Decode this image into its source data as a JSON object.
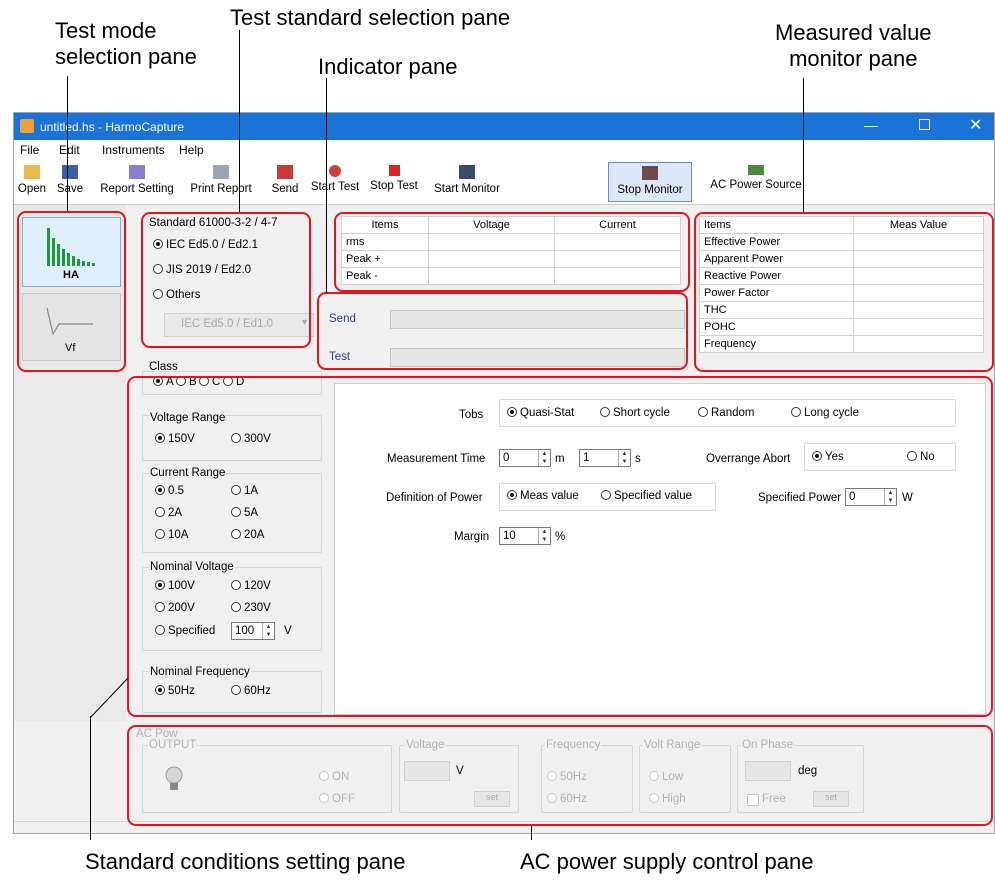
{
  "annotations": {
    "test_mode": "Test mode\nselection pane",
    "test_standard": "Test standard selection pane",
    "indicator": "Indicator pane",
    "measured_value": "Measured value\nmonitor pane",
    "standard_conditions": "Standard conditions setting pane",
    "ac_power": "AC power supply control pane"
  },
  "window": {
    "title": "untitled.hs - HarmoCapture"
  },
  "menu": [
    "File",
    "Edit",
    "Instruments",
    "Help"
  ],
  "toolbar": [
    "Open",
    "Save",
    "Report Setting",
    "Print Report",
    "Send",
    "Start Test",
    "Stop Test",
    "Start Monitor",
    "Stop Monitor",
    "AC Power Source"
  ],
  "mode": {
    "ha": "HA",
    "vf": "Vf"
  },
  "standard": {
    "label": "Standard  61000-3-2 / 4-7",
    "opt1": "IEC Ed5.0 / Ed2.1",
    "opt2": "JIS 2019 / Ed2.0",
    "opt3": "Others",
    "dropdown": "IEC Ed5.0 / Ed1.0"
  },
  "class": {
    "label": "Class",
    "a": "A",
    "b": "B",
    "c": "C",
    "d": "D"
  },
  "voltage_range": {
    "label": "Voltage Range",
    "o1": "150V",
    "o2": "300V"
  },
  "current_range": {
    "label": "Current Range",
    "o1": "0.5",
    "o2": "1A",
    "o3": "2A",
    "o4": "5A",
    "o5": "10A",
    "o6": "20A"
  },
  "nominal_voltage": {
    "label": "Nominal Voltage",
    "o1": "100V",
    "o2": "120V",
    "o3": "200V",
    "o4": "230V",
    "o5": "Specified",
    "value": "100",
    "unit": "V"
  },
  "nominal_frequency": {
    "label": "Nominal Frequency",
    "o1": "50Hz",
    "o2": "60Hz"
  },
  "measure_table": {
    "headers": [
      "Items",
      "Voltage",
      "Current"
    ],
    "rows": [
      "rms",
      "Peak +",
      "Peak -"
    ]
  },
  "indicator": {
    "send": "Send",
    "test": "Test"
  },
  "monitor": {
    "headers": [
      "Items",
      "Meas Value"
    ],
    "rows": [
      "Effective Power",
      "Apparent Power",
      "Reactive Power",
      "Power Factor",
      "THC",
      "POHC",
      "Frequency"
    ]
  },
  "conditions": {
    "tobs": "Tobs",
    "tobs_o1": "Quasi-Stat",
    "tobs_o2": "Short cycle",
    "tobs_o3": "Random",
    "tobs_o4": "Long cycle",
    "meas_time": "Measurement Time",
    "meas_m": "0",
    "m_unit": "m",
    "meas_s": "1",
    "s_unit": "s",
    "overrange": "Overrange Abort",
    "yes": "Yes",
    "no": "No",
    "def_power": "Definition of Power",
    "meas_value": "Meas value",
    "specified_value": "Specified value",
    "spec_power": "Specified Power",
    "spec_power_val": "0",
    "w_unit": "W",
    "margin": "Margin",
    "margin_val": "10",
    "pct": "%"
  },
  "ac": {
    "title": "AC Pow",
    "output": "OUTPUT",
    "on": "ON",
    "off": "OFF",
    "voltage": "Voltage",
    "v": "V",
    "set": "set",
    "frequency": "Frequency",
    "f50": "50Hz",
    "f60": "60Hz",
    "range": "Volt Range",
    "low": "Low",
    "high": "High",
    "phase": "On Phase",
    "deg": "deg",
    "free": "Free"
  },
  "colors": {
    "title_bar": "#1a73d6",
    "highlight": "#e8131f",
    "indicator_text": "#2a3ea0",
    "ha_bars": "#1e9a3a"
  }
}
